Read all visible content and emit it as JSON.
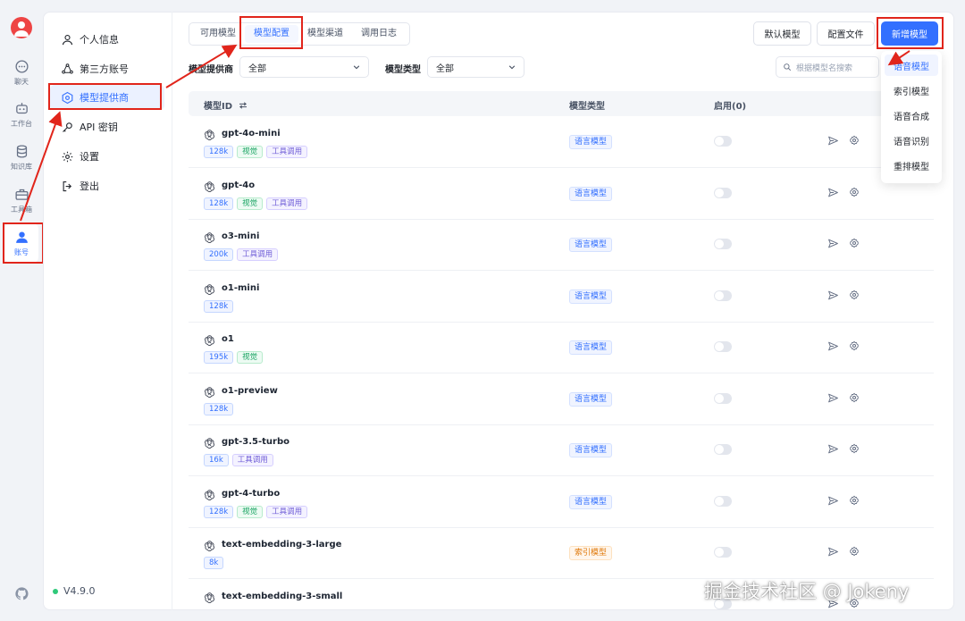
{
  "rail": {
    "items": [
      {
        "label": "聊天",
        "icon": "chat-icon"
      },
      {
        "label": "工作台",
        "icon": "robot-icon"
      },
      {
        "label": "知识库",
        "icon": "database-icon"
      },
      {
        "label": "工具箱",
        "icon": "toolbox-icon"
      },
      {
        "label": "账号",
        "icon": "user-icon"
      }
    ],
    "github_icon": "github-icon"
  },
  "nav": {
    "items": [
      {
        "label": "个人信息",
        "icon": "user-icon"
      },
      {
        "label": "第三方账号",
        "icon": "connections-icon"
      },
      {
        "label": "模型提供商",
        "icon": "model-provider-icon"
      },
      {
        "label": "API 密钥",
        "icon": "key-icon"
      },
      {
        "label": "设置",
        "icon": "settings-icon"
      },
      {
        "label": "登出",
        "icon": "logout-icon"
      }
    ],
    "version": "V4.9.0"
  },
  "tabs": [
    "可用模型",
    "模型配置",
    "模型渠道",
    "调用日志"
  ],
  "actions": {
    "default_model": "默认模型",
    "config_file": "配置文件",
    "add_model": "新增模型"
  },
  "filters": {
    "provider_label": "模型提供商",
    "provider_value": "全部",
    "type_label": "模型类型",
    "type_value": "全部",
    "search_placeholder": "根据模型名搜索"
  },
  "table": {
    "headers": {
      "id": "模型ID",
      "type": "模型类型",
      "enabled": "启用(0)"
    },
    "rows": [
      {
        "id": "gpt-4o-mini",
        "tags": [
          {
            "t": "128k",
            "k": "ctx"
          },
          {
            "t": "视觉",
            "k": "vision"
          },
          {
            "t": "工具调用",
            "k": "tool"
          }
        ],
        "type": "语言模型",
        "kind": "lang"
      },
      {
        "id": "gpt-4o",
        "tags": [
          {
            "t": "128k",
            "k": "ctx"
          },
          {
            "t": "视觉",
            "k": "vision"
          },
          {
            "t": "工具调用",
            "k": "tool"
          }
        ],
        "type": "语言模型",
        "kind": "lang"
      },
      {
        "id": "o3-mini",
        "tags": [
          {
            "t": "200k",
            "k": "ctx"
          },
          {
            "t": "工具调用",
            "k": "tool"
          }
        ],
        "type": "语言模型",
        "kind": "lang"
      },
      {
        "id": "o1-mini",
        "tags": [
          {
            "t": "128k",
            "k": "ctx"
          }
        ],
        "type": "语言模型",
        "kind": "lang"
      },
      {
        "id": "o1",
        "tags": [
          {
            "t": "195k",
            "k": "ctx"
          },
          {
            "t": "视觉",
            "k": "vision"
          }
        ],
        "type": "语言模型",
        "kind": "lang"
      },
      {
        "id": "o1-preview",
        "tags": [
          {
            "t": "128k",
            "k": "ctx"
          }
        ],
        "type": "语言模型",
        "kind": "lang"
      },
      {
        "id": "gpt-3.5-turbo",
        "tags": [
          {
            "t": "16k",
            "k": "ctx"
          },
          {
            "t": "工具调用",
            "k": "tool"
          }
        ],
        "type": "语言模型",
        "kind": "lang"
      },
      {
        "id": "gpt-4-turbo",
        "tags": [
          {
            "t": "128k",
            "k": "ctx"
          },
          {
            "t": "视觉",
            "k": "vision"
          },
          {
            "t": "工具调用",
            "k": "tool"
          }
        ],
        "type": "语言模型",
        "kind": "lang"
      },
      {
        "id": "text-embedding-3-large",
        "tags": [
          {
            "t": "8k",
            "k": "ctx"
          }
        ],
        "type": "索引模型",
        "kind": "index"
      },
      {
        "id": "text-embedding-3-small",
        "tags": [],
        "type": "",
        "kind": "lang"
      }
    ]
  },
  "add_menu": [
    "语音模型",
    "索引模型",
    "语音合成",
    "语音识别",
    "重排模型"
  ],
  "watermark": "掘金技术社区 @ Jokeny",
  "colors": {
    "accent": "#3370ff",
    "highlight": "#e1251b"
  }
}
